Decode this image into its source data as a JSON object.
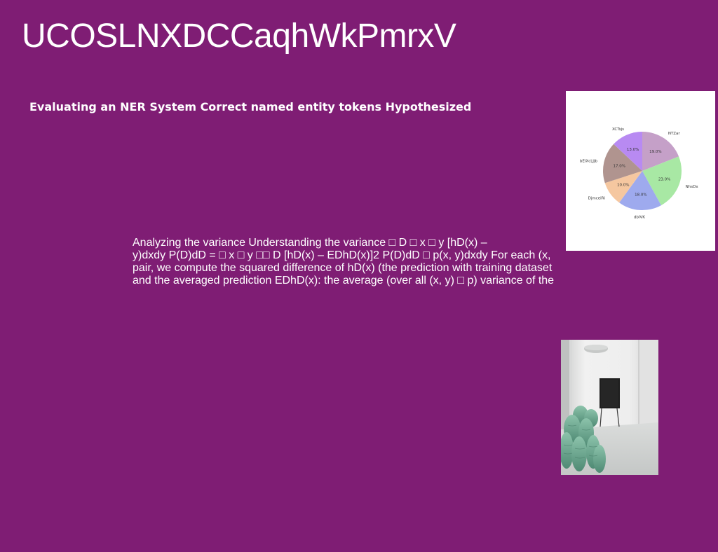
{
  "slide": {
    "title": "UCOSLNXDCCaqhWkPmrxV",
    "heading": "Evaluating an NER System Correct named entity tokens Hypothesized",
    "body_lines": [
      "Analyzing the variance Understanding the variance □ D □ x □ y [hD(x) –",
      "y)dxdy P(D)dD = □ x □ y □□ D [hD(x) – EDhD(x)]2 P(D)dD □ p(x, y)dxdy For each (x,",
      "pair, we compute the squared difference of hD(x) (the prediction with training dataset",
      "and the averaged prediction EDhD(x): the average (over all (x, y) □ p) variance of the"
    ]
  },
  "chart_data": {
    "type": "pie",
    "title": "",
    "slices": [
      {
        "label": "NTZar",
        "value": 19.0,
        "pct_label": "19.0%",
        "color": "#c5a0c8"
      },
      {
        "label": "NhsDx",
        "value": 23.0,
        "pct_label": "23.0%",
        "color": "#a8e8a4"
      },
      {
        "label": "dbIVK",
        "value": 18.0,
        "pct_label": "18.0%",
        "color": "#9eaaee"
      },
      {
        "label": "DjmceiRi",
        "value": 10.0,
        "pct_label": "10.0%",
        "color": "#f5c7a0"
      },
      {
        "label": "bEIXcLJJb",
        "value": 17.0,
        "pct_label": "17.0%",
        "color": "#b0948f"
      },
      {
        "label": "XCTsjs",
        "value": 13.0,
        "pct_label": "13.0%",
        "color": "#b88af2"
      }
    ],
    "start": "top",
    "direction": "clockwise",
    "legend": "none"
  },
  "photo": {
    "subject": "interior-room-photo",
    "colors": {
      "wall": "#e8e8e8",
      "floor": "#d4d6d5",
      "sofa": "#6fa892",
      "easel": "#1e1e1e"
    }
  }
}
